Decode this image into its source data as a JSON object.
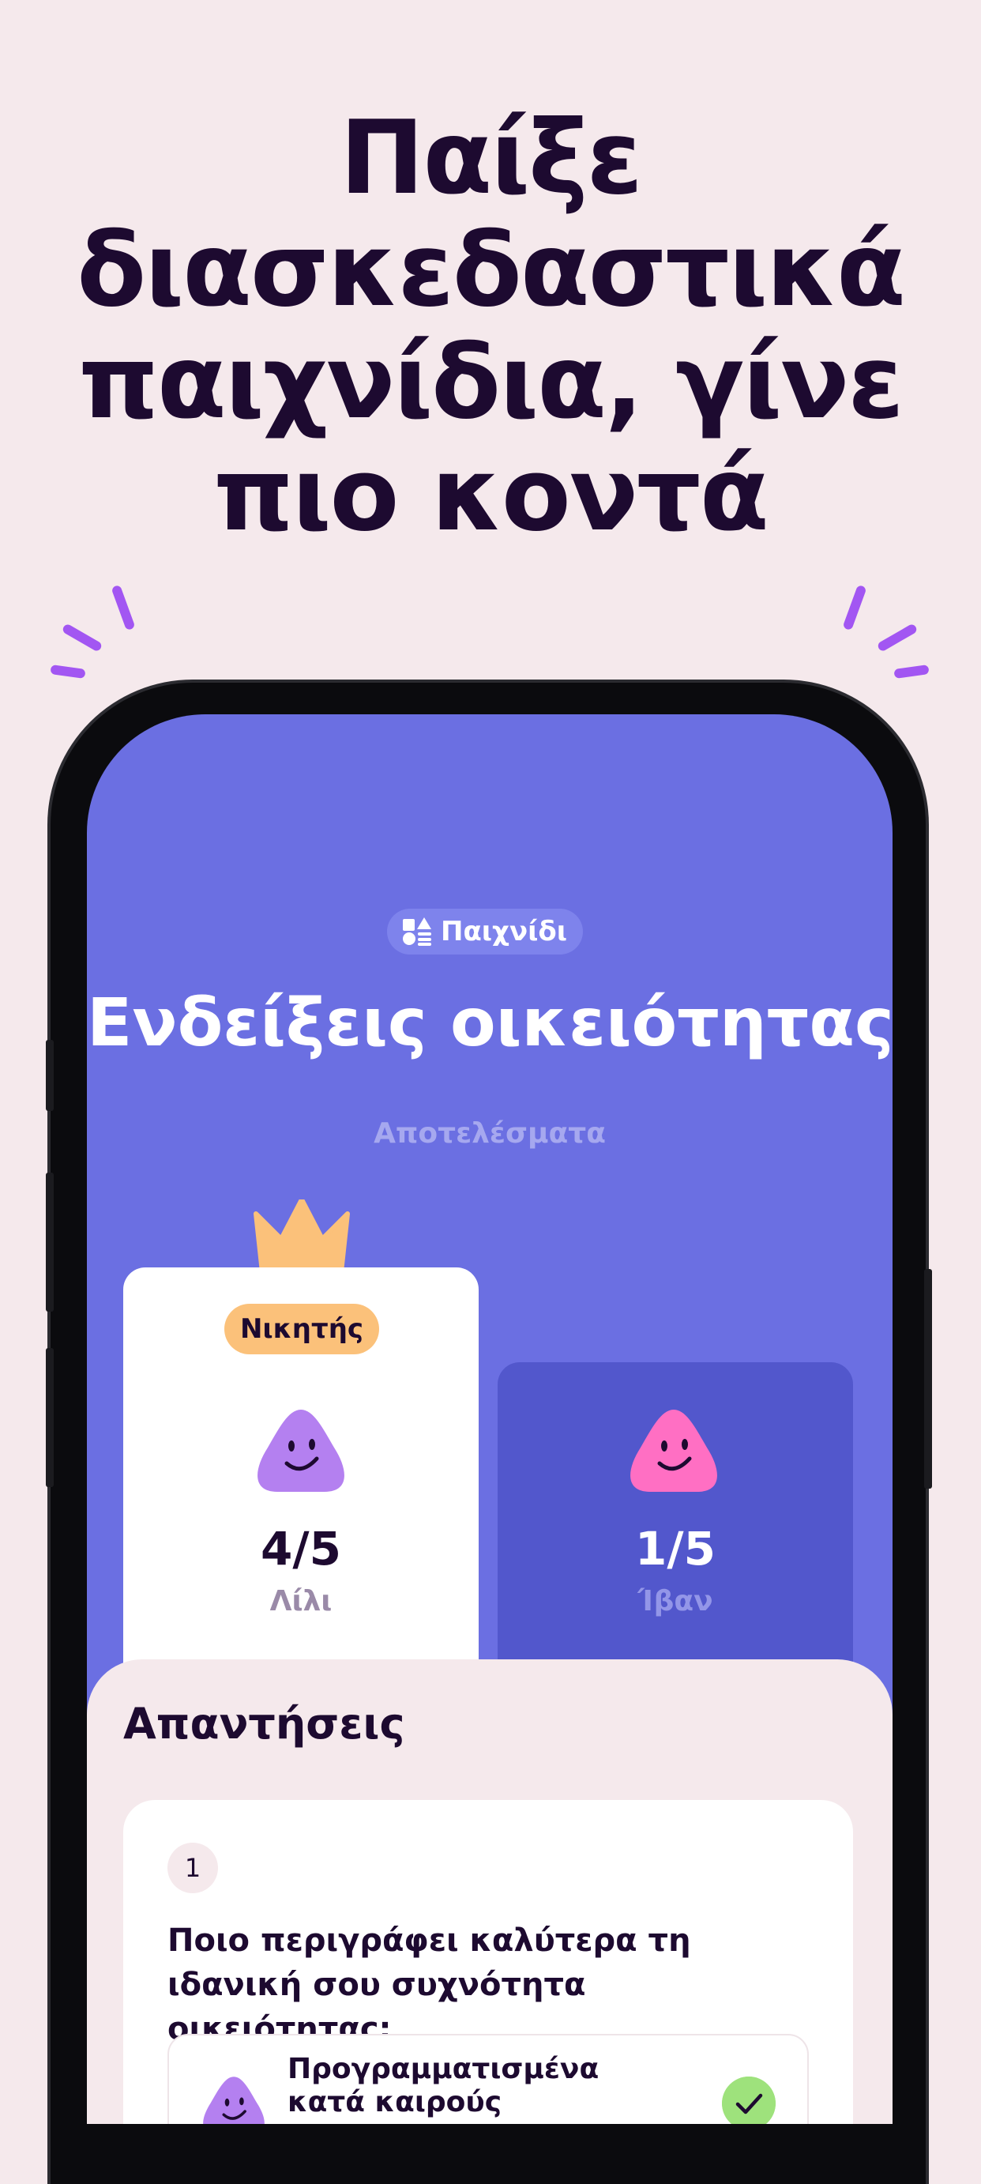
{
  "headline": {
    "lines": [
      "Παίξε",
      "διασκεδαστικά",
      "παιχνίδια, γίνε",
      "πιο κοντά"
    ]
  },
  "colors": {
    "background": "#f5e9ec",
    "screen": "#6b6fe2",
    "accent_purple": "#a256f2",
    "winner_badge": "#fbc17a",
    "text_dark": "#1d0a30"
  },
  "game": {
    "chip_icon": "shapes-icon",
    "chip_label": "Παιχνίδι",
    "title": "Ενδείξεις οικειότητας",
    "results_label": "Αποτελέσματα"
  },
  "players": [
    {
      "badge": "Νικητής",
      "score": "4/5",
      "name": "Λίλι",
      "avatar": "purple-blob-avatar",
      "color": "#b480f0"
    },
    {
      "score": "1/5",
      "name": "Ίβαν",
      "avatar": "pink-blob-avatar",
      "color": "#ff6fc3"
    }
  ],
  "answers": {
    "title": "Απαντήσεις",
    "question_number": "1",
    "question": "Ποιο περιγράφει καλύτερα τη ιδανική σου συχνότητα οικειότητας;",
    "answer_text": "Προγραμματισμένα κατά καιρούς",
    "answer_icon": "check-icon"
  }
}
